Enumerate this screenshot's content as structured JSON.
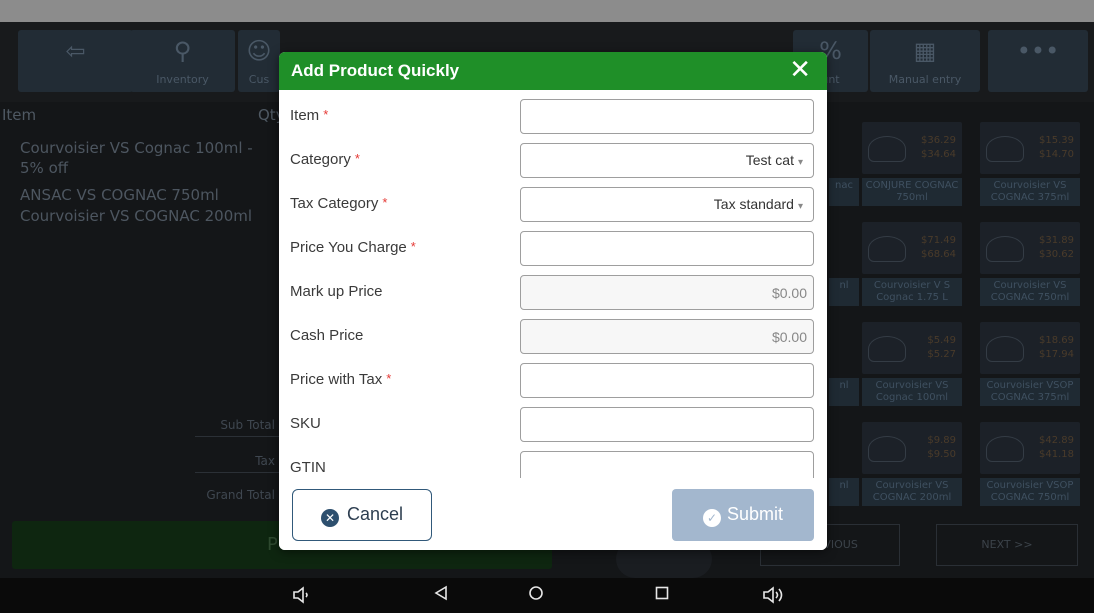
{
  "toolbar": {
    "buttons": [
      {
        "label": "",
        "icon": "back-arrow-icon"
      },
      {
        "label": "Inventory",
        "icon": "search-icon"
      },
      {
        "label": "Cus",
        "icon": "person-icon"
      },
      {
        "label": "",
        "icon": "gift-icon"
      },
      {
        "label": "",
        "icon": "cart-icon"
      },
      {
        "label": "",
        "icon": "trash-icon"
      },
      {
        "label": "",
        "icon": "return-icon"
      },
      {
        "label": "unt",
        "icon": "percent-icon"
      },
      {
        "label": "Manual entry",
        "icon": "calculator-icon"
      },
      {
        "label": "",
        "icon": "more-icon"
      }
    ]
  },
  "cart": {
    "header_item": "Item",
    "header_qty": "Qty",
    "items": [
      "Courvoisier VS Cognac 100ml - 5% off",
      "ANSAC VS COGNAC 750ml",
      "Courvoisier VS COGNAC 200ml"
    ],
    "totals": [
      "Sub Total",
      "Tax",
      "Grand Total"
    ],
    "pay_label": "P"
  },
  "products": {
    "cards": [
      {
        "price": "$36.29",
        "sub": "$34.64",
        "label": "CONJURE COGNAC 750ml"
      },
      {
        "price": "$15.39",
        "sub": "$14.70",
        "label": "Courvoisier VS COGNAC 375ml"
      },
      {
        "price": "$71.49",
        "sub": "$68.64",
        "label": "Courvoisier V S Cognac 1.75 L"
      },
      {
        "price": "$31.89",
        "sub": "$30.62",
        "label": "Courvoisier VS COGNAC 750ml"
      },
      {
        "price": "$5.49",
        "sub": "$5.27",
        "label": "Courvoisier VS Cognac 100ml"
      },
      {
        "price": "$18.69",
        "sub": "$17.94",
        "label": "Courvoisier VSOP COGNAC 375ml"
      },
      {
        "price": "$9.89",
        "sub": "$9.50",
        "label": "Courvoisier VS COGNAC 200ml"
      },
      {
        "price": "$42.89",
        "sub": "$41.18",
        "label": "Courvoisier VSOP COGNAC 750ml"
      }
    ],
    "edge_labels": [
      "nac",
      "nl",
      "nl",
      "nl"
    ],
    "prev_label": "PREVIOUS",
    "next_label": "NEXT >>"
  },
  "modal": {
    "title": "Add Product Quickly",
    "close_glyph": "✕",
    "fields": [
      {
        "label": "Item",
        "required": true,
        "type": "text",
        "value": ""
      },
      {
        "label": "Category",
        "required": true,
        "type": "select",
        "value": "Test cat"
      },
      {
        "label": "Tax Category",
        "required": true,
        "type": "select",
        "value": "Tax standard"
      },
      {
        "label": "Price You Charge",
        "required": true,
        "type": "text",
        "value": ""
      },
      {
        "label": "Mark up Price",
        "required": false,
        "type": "text",
        "value": "$0.00"
      },
      {
        "label": "Cash Price",
        "required": false,
        "type": "text",
        "value": "$0.00"
      },
      {
        "label": "Price with Tax",
        "required": true,
        "type": "text",
        "value": ""
      },
      {
        "label": "SKU",
        "required": false,
        "type": "text",
        "value": ""
      },
      {
        "label": "GTIN",
        "required": false,
        "type": "text",
        "value": ""
      }
    ],
    "required_marker": "*",
    "cancel_label": "Cancel",
    "submit_label": "Submit"
  },
  "navbar": {
    "buttons": [
      "volume-down-icon",
      "back-icon",
      "home-icon",
      "recents-icon",
      "volume-up-icon"
    ]
  },
  "colors": {
    "header_green": "#1f8f28",
    "submit_disabled": "#a3b7ce",
    "required_red": "#e53935"
  }
}
